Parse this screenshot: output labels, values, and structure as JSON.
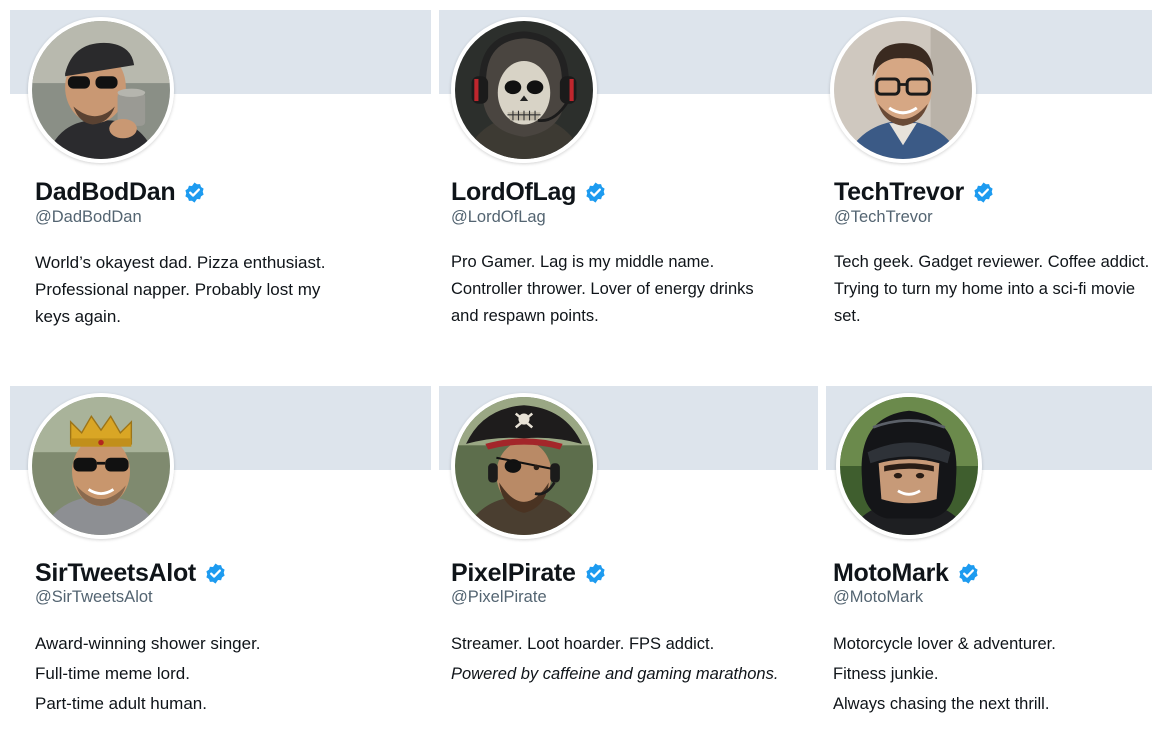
{
  "profiles": [
    {
      "name": "DadBodDan",
      "handle": "@DadBodDan",
      "verified": true,
      "avatar": "man-with-sunglasses-drinking-coffee",
      "bio": [
        "World’s okayest dad. Pizza enthusiast.",
        "Professional napper. Probably lost my",
        "keys again."
      ]
    },
    {
      "name": "LordOfLag",
      "handle": "@LordOfLag",
      "verified": true,
      "avatar": "skull-mask-gamer-with-headset",
      "bio": [
        "Pro Gamer. Lag is my middle name.",
        "Controller thrower. Lover of energy drinks",
        "and respawn points."
      ]
    },
    {
      "name": "TechTrevor",
      "handle": "@TechTrevor",
      "verified": true,
      "avatar": "smiling-man-with-glasses",
      "bio": [
        "Tech geek. Gadget reviewer. Coffee addict.",
        "Trying to turn my home into a sci-fi movie",
        "set."
      ]
    },
    {
      "name": "SirTweetsAlot",
      "handle": "@SirTweetsAlot",
      "verified": true,
      "avatar": "man-with-crown-and-sunglasses",
      "bio": [
        "Award-winning shower singer.",
        "Full-time meme lord.",
        "Part-time adult human."
      ]
    },
    {
      "name": "PixelPirate",
      "handle": "@PixelPirate",
      "verified": true,
      "avatar": "pirate-with-eyepatch-and-headset",
      "bio": [
        "Streamer. Loot hoarder. FPS addict.",
        "Powered by caffeine and gaming marathons."
      ]
    },
    {
      "name": "MotoMark",
      "handle": "@MotoMark",
      "verified": true,
      "avatar": "man-in-motorcycle-helmet",
      "bio": [
        "Motorcycle lover & adventurer.",
        "Fitness junkie.",
        "Always chasing the next thrill."
      ]
    }
  ],
  "colors": {
    "banner": "#dde4ec",
    "verified_badge": "#1d9bf0",
    "handle_text": "#536471",
    "primary_text": "#0f1419"
  }
}
